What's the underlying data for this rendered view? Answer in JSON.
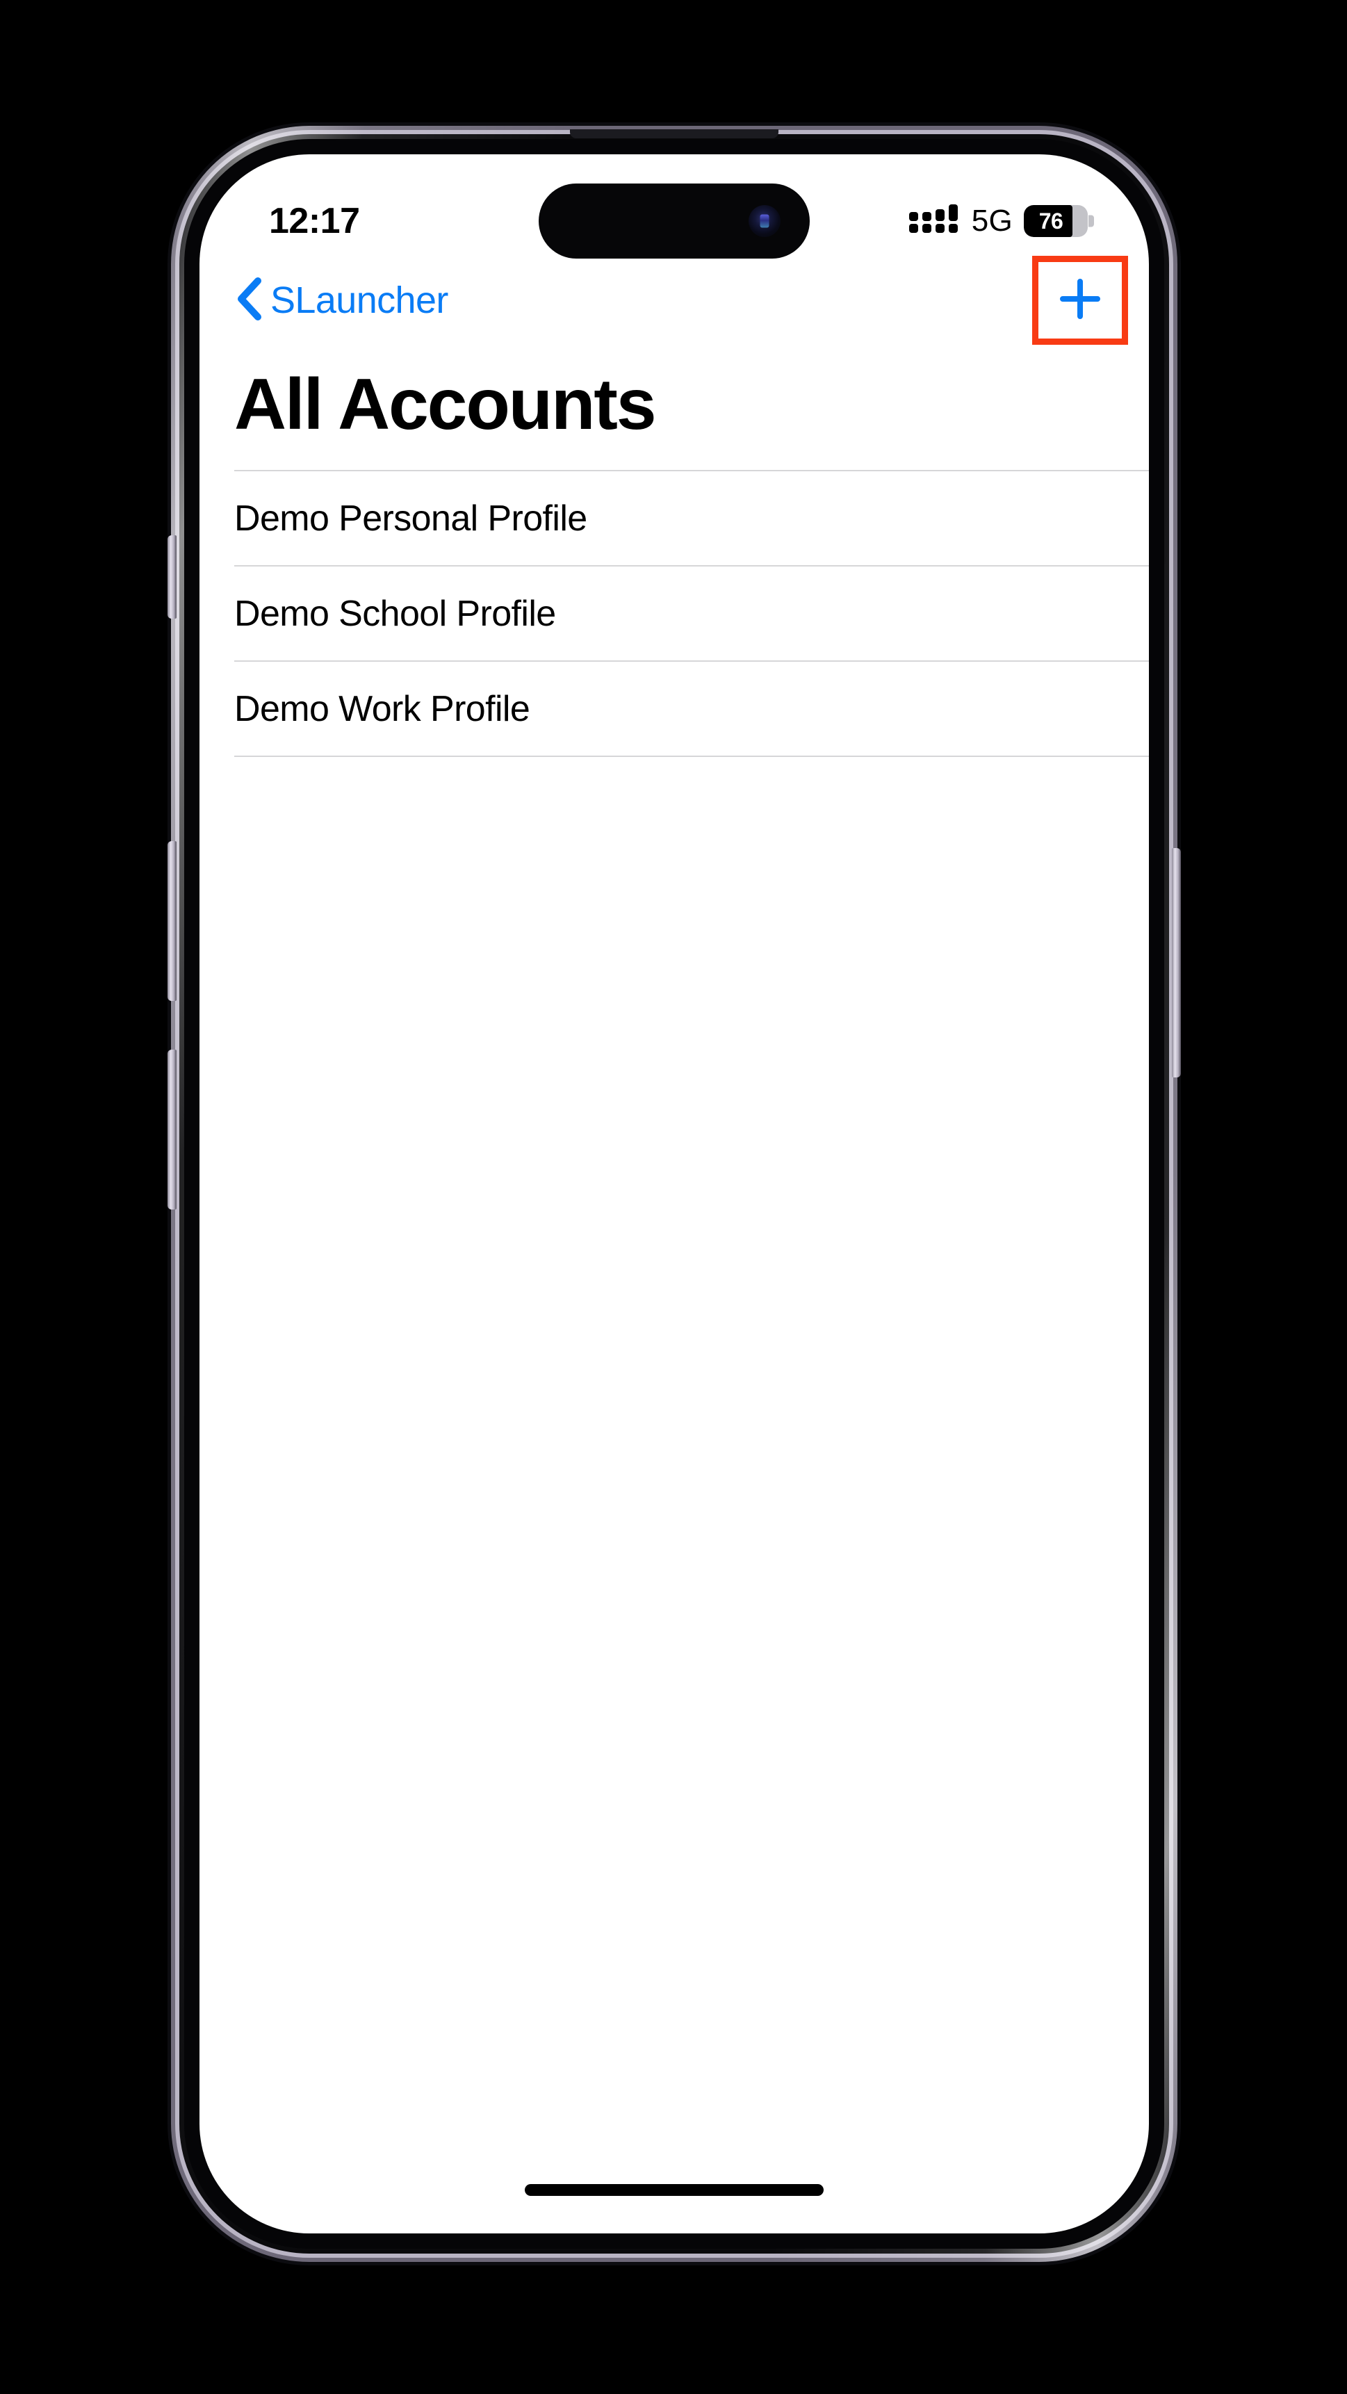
{
  "status_bar": {
    "time": "12:17",
    "network": "5G",
    "battery_level": "76",
    "battery_percent": 76,
    "signal_icon": "cellular-signal-icon",
    "battery_icon": "battery-icon"
  },
  "nav_bar": {
    "back_label": "SLauncher",
    "back_icon": "chevron-left-icon",
    "add_icon": "plus-icon",
    "accent_color": "#0a7cf5",
    "highlight_color": "#f83b14"
  },
  "header": {
    "title": "All Accounts"
  },
  "accounts": [
    {
      "label": "Demo Personal Profile"
    },
    {
      "label": "Demo School Profile"
    },
    {
      "label": "Demo Work Profile"
    }
  ],
  "device": {
    "dynamic_island": "dynamic-island",
    "front_camera": "front-camera-icon",
    "home_indicator": "home-indicator",
    "buttons": [
      {
        "name": "action-button"
      },
      {
        "name": "volume-up-button"
      },
      {
        "name": "volume-down-button"
      },
      {
        "name": "power-button"
      }
    ]
  }
}
